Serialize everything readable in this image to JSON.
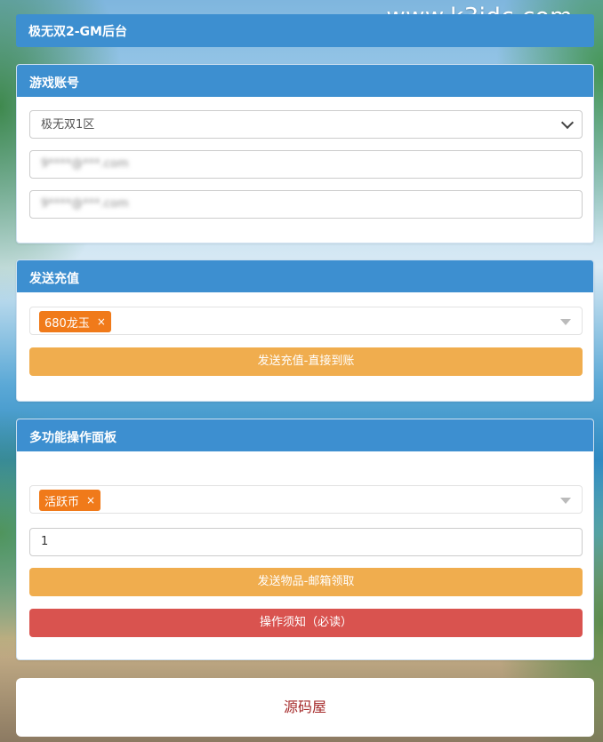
{
  "watermark": "www.k3idc.com",
  "app_title": "极无双2-GM后台",
  "account_panel": {
    "title": "游戏账号",
    "server_select": {
      "selected": "极无双1区",
      "options": [
        "极无双1区"
      ]
    },
    "account_field": {
      "value": "9****@***.com"
    },
    "password_field": {
      "value": "9****@***.com"
    }
  },
  "recharge_panel": {
    "title": "发送充值",
    "selected_tag": "680龙玉",
    "tag_remove": "×",
    "send_button": "发送充值-直接到账"
  },
  "multi_panel": {
    "title": "多功能操作面板",
    "selected_tag": "活跃币",
    "tag_remove": "×",
    "quantity": "1",
    "send_button": "发送物品-邮箱领取",
    "notice_button": "操作须知（必读）"
  },
  "footer": {
    "text": "源码屋"
  }
}
